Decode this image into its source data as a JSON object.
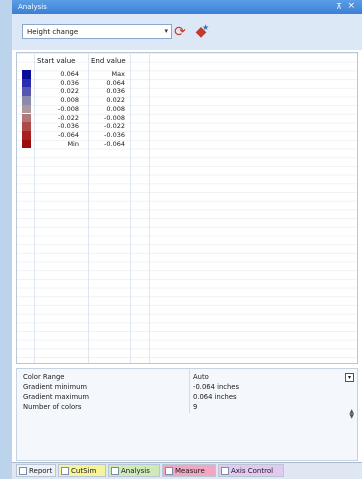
{
  "window": {
    "title": "Analysis",
    "pin_glyph": "⊼",
    "close_glyph": "×"
  },
  "toolbar": {
    "mode_value": "Height change",
    "icons": [
      "refresh-icon",
      "color-settings-icon"
    ]
  },
  "table": {
    "headers": {
      "start": "Start value",
      "end": "End value"
    },
    "rows": [
      {
        "color": "#0c0c9a",
        "start": "0.064",
        "end": "Max"
      },
      {
        "color": "#2b2bb0",
        "start": "0.036",
        "end": "0.064"
      },
      {
        "color": "#5656b0",
        "start": "0.022",
        "end": "0.036"
      },
      {
        "color": "#8a8aac",
        "start": "0.008",
        "end": "0.022"
      },
      {
        "color": "#aa9a9e",
        "start": "-0.008",
        "end": "0.008"
      },
      {
        "color": "#b07878",
        "start": "-0.022",
        "end": "-0.008"
      },
      {
        "color": "#ad4a4a",
        "start": "-0.036",
        "end": "-0.022"
      },
      {
        "color": "#a82020",
        "start": "-0.064",
        "end": "-0.036"
      },
      {
        "color": "#9e0a0a",
        "start": "Min",
        "end": "-0.064"
      }
    ]
  },
  "properties": [
    {
      "name": "Color Range",
      "value": "Auto"
    },
    {
      "name": "Gradient minimum",
      "value": "-0.064 inches"
    },
    {
      "name": "Gradient maximum",
      "value": "0.064 inches"
    },
    {
      "name": "Number of colors",
      "value": "9"
    }
  ],
  "tabs": [
    {
      "label": "Report",
      "bg": "#eef2f8"
    },
    {
      "label": "CutSim",
      "bg": "#f6f39a"
    },
    {
      "label": "Analysis",
      "bg": "#cfe9b8"
    },
    {
      "label": "Measure",
      "bg": "#f2a6c0"
    },
    {
      "label": "Axis Control",
      "bg": "#e3c9f0"
    }
  ]
}
